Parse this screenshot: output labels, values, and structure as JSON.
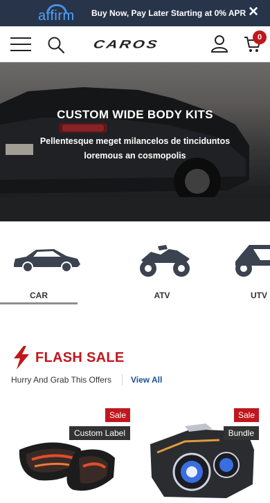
{
  "promo": {
    "brand": "affirm",
    "text": "Buy Now, Pay Later Starting at 0% APR",
    "close": "✕"
  },
  "header": {
    "logo": "CAROS",
    "cart_count": "0",
    "icons": [
      "menu-icon",
      "search-icon",
      "user-icon",
      "cart-icon"
    ]
  },
  "hero": {
    "title": "CUSTOM WIDE BODY KITS",
    "subtitle": "Pellentesque meget milancelos de tinciduntos loremous an cosmopolis"
  },
  "categories": {
    "items": [
      {
        "label": "CAR",
        "icon": "car-icon",
        "selected": true
      },
      {
        "label": "ATV",
        "icon": "atv-icon",
        "selected": false
      },
      {
        "label": "UTV",
        "icon": "utv-icon",
        "selected": false
      }
    ]
  },
  "flash_sale": {
    "title": "FLASH SALE",
    "subtitle": "Hurry And Grab This Offers",
    "view_all": "View All"
  },
  "products": [
    {
      "sale": "Sale",
      "tag": "Custom Label"
    },
    {
      "sale": "Sale",
      "tag": "Bundle"
    }
  ],
  "colors": {
    "promo_bg": "#27344a",
    "accent_red": "#c0171d",
    "link_blue": "#1a4f9c"
  }
}
